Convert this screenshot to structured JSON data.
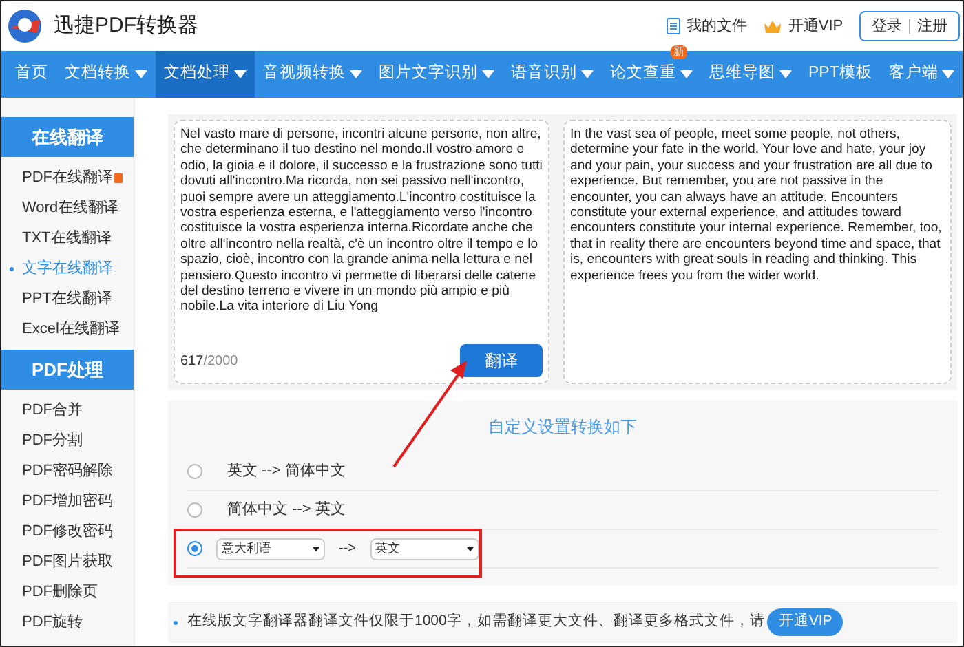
{
  "header": {
    "logo_text": "迅捷PDF转换器",
    "links": [
      {
        "label": "我的文件",
        "kind": "file"
      },
      {
        "label": "开通VIP",
        "kind": "vip"
      }
    ],
    "login": "登录",
    "register": "注册",
    "separator": "|"
  },
  "nav": [
    {
      "label": "首页",
      "dropdown": false,
      "selected": false
    },
    {
      "label": "文档转换",
      "dropdown": true,
      "selected": false
    },
    {
      "label": "文档处理",
      "dropdown": true,
      "selected": true
    },
    {
      "label": "音视频转换",
      "dropdown": true,
      "selected": false
    },
    {
      "label": "图片文字识别",
      "dropdown": true,
      "selected": false
    },
    {
      "label": "语音识别",
      "dropdown": true,
      "selected": false
    },
    {
      "label": "论文查重",
      "dropdown": true,
      "selected": false,
      "badge": "新"
    },
    {
      "label": "思维导图",
      "dropdown": true,
      "selected": false
    },
    {
      "label": "PPT模板",
      "dropdown": false,
      "selected": false
    },
    {
      "label": "客户端",
      "dropdown": true,
      "selected": false
    }
  ],
  "sidebar": [
    {
      "title": "在线翻译",
      "items": [
        {
          "label": "PDF在线翻译",
          "selected": false,
          "flag": true
        },
        {
          "label": "Word在线翻译",
          "selected": false,
          "flag": false
        },
        {
          "label": "TXT在线翻译",
          "selected": false,
          "flag": false
        },
        {
          "label": "文字在线翻译",
          "selected": true,
          "flag": false
        },
        {
          "label": "PPT在线翻译",
          "selected": false,
          "flag": false
        },
        {
          "label": "Excel在线翻译",
          "selected": false,
          "flag": false
        }
      ]
    },
    {
      "title": "PDF处理",
      "items": [
        {
          "label": "PDF合并",
          "selected": false,
          "flag": false
        },
        {
          "label": "PDF分割",
          "selected": false,
          "flag": false
        },
        {
          "label": "PDF密码解除",
          "selected": false,
          "flag": false
        },
        {
          "label": "PDF增加密码",
          "selected": false,
          "flag": false
        },
        {
          "label": "PDF修改密码",
          "selected": false,
          "flag": false
        },
        {
          "label": "PDF图片获取",
          "selected": false,
          "flag": false
        },
        {
          "label": "PDF删除页",
          "selected": false,
          "flag": false
        },
        {
          "label": "PDF旋转",
          "selected": false,
          "flag": false
        }
      ]
    }
  ],
  "source_text": "Nel vasto mare di persone, incontri alcune persone, non altre, che determinano il tuo destino nel mondo.Il vostro amore e odio, la gioia e il dolore, il successo e la frustrazione sono tutti dovuti all'incontro.Ma ricorda, non sei passivo nell'incontro, puoi sempre avere un atteggiamento.L'incontro costituisce la vostra esperienza esterna, e l'atteggiamento verso l'incontro costituisce la vostra esperienza interna.Ricordate anche che oltre all'incontro nella realtà, c'è un incontro oltre il tempo e lo spazio, cioè, incontro con la grande anima nella lettura e nel pensiero.Questo incontro vi permette di liberarsi delle catene del destino terreno e vivere in un mondo più ampio e più nobile.La vita interiore di Liu Yong",
  "char_count": "617",
  "char_limit": "/2000",
  "translate_button": "翻译",
  "result_text": "In the vast sea of people, meet some people, not others, determine your fate in the world. Your love and hate, your joy and your pain, your success and your frustration are all due to experience. But remember, you are not passive in the encounter, you can always have an attitude. Encounters constitute your external experience, and attitudes toward encounters constitute your internal experience. Remember, too, that in reality there are encounters beyond time and space, that is, encounters with great souls in reading and thinking. This experience frees you from the wider world.",
  "settings_title": "自定义设置转换如下",
  "options": [
    {
      "kind": "fixed",
      "label": "英文 --> 简体中文",
      "selected": false
    },
    {
      "kind": "fixed",
      "label": "简体中文 --> 英文",
      "selected": false
    },
    {
      "kind": "custom",
      "from": "意大利语",
      "arrow": "-->",
      "to": "英文",
      "selected": true,
      "highlighted": true
    }
  ],
  "notice": {
    "text": "在线版文字翻译器翻译文件仅限于1000字，如需翻译更大文件、翻译更多格式文件，请",
    "button": "开通VIP"
  }
}
